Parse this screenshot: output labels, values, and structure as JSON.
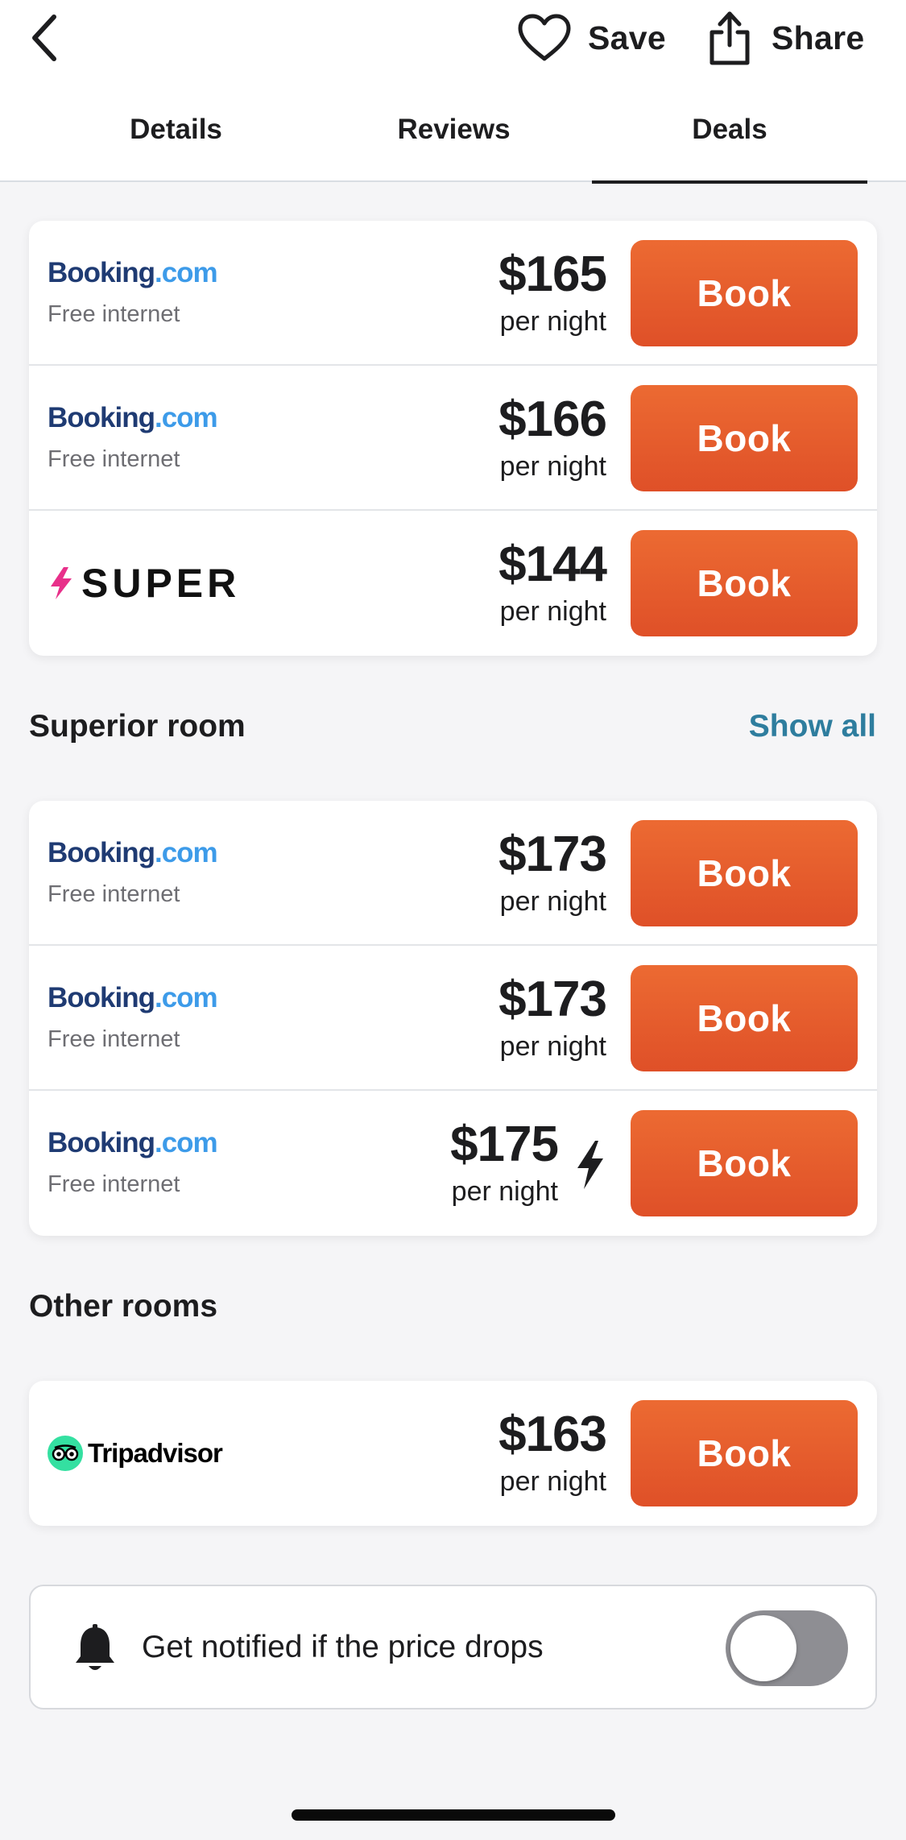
{
  "topbar": {
    "save_label": "Save",
    "share_label": "Share"
  },
  "tabs": [
    {
      "label": "Details"
    },
    {
      "label": "Reviews"
    },
    {
      "label": "Deals",
      "active": true
    }
  ],
  "deals_group_1": [
    {
      "provider": "Booking.com",
      "logo_part1": "Booking",
      "logo_part2": ".com",
      "amenity": "Free internet",
      "price": "$165",
      "unit": "per night",
      "button": "Book"
    },
    {
      "provider": "Booking.com",
      "logo_part1": "Booking",
      "logo_part2": ".com",
      "amenity": "Free internet",
      "price": "$166",
      "unit": "per night",
      "button": "Book"
    },
    {
      "provider": "SUPER",
      "logo_text": "SUPER",
      "price": "$144",
      "unit": "per night",
      "button": "Book"
    }
  ],
  "superior": {
    "title": "Superior room",
    "show_all": "Show all",
    "deals": [
      {
        "provider": "Booking.com",
        "logo_part1": "Booking",
        "logo_part2": ".com",
        "amenity": "Free internet",
        "price": "$173",
        "unit": "per night",
        "button": "Book"
      },
      {
        "provider": "Booking.com",
        "logo_part1": "Booking",
        "logo_part2": ".com",
        "amenity": "Free internet",
        "price": "$173",
        "unit": "per night",
        "button": "Book"
      },
      {
        "provider": "Booking.com",
        "logo_part1": "Booking",
        "logo_part2": ".com",
        "amenity": "Free internet",
        "price": "$175",
        "unit": "per night",
        "button": "Book",
        "flash_icon": "lightning-bolt-icon"
      }
    ]
  },
  "other": {
    "title": "Other rooms",
    "deals": [
      {
        "provider": "Tripadvisor",
        "logo_text": "Tripadvisor",
        "price": "$163",
        "unit": "per night",
        "button": "Book"
      }
    ]
  },
  "notify": {
    "text": "Get notified if the price drops",
    "toggle_on": false
  },
  "colors": {
    "book_button": "#e45d2c",
    "booking_dark": "#1f3b73",
    "booking_light": "#3d9be9",
    "link": "#2e7d9e",
    "super_bolt": "#e8308a",
    "tripadvisor_green": "#34e0a1",
    "toggle_off": "#8e8e93"
  }
}
